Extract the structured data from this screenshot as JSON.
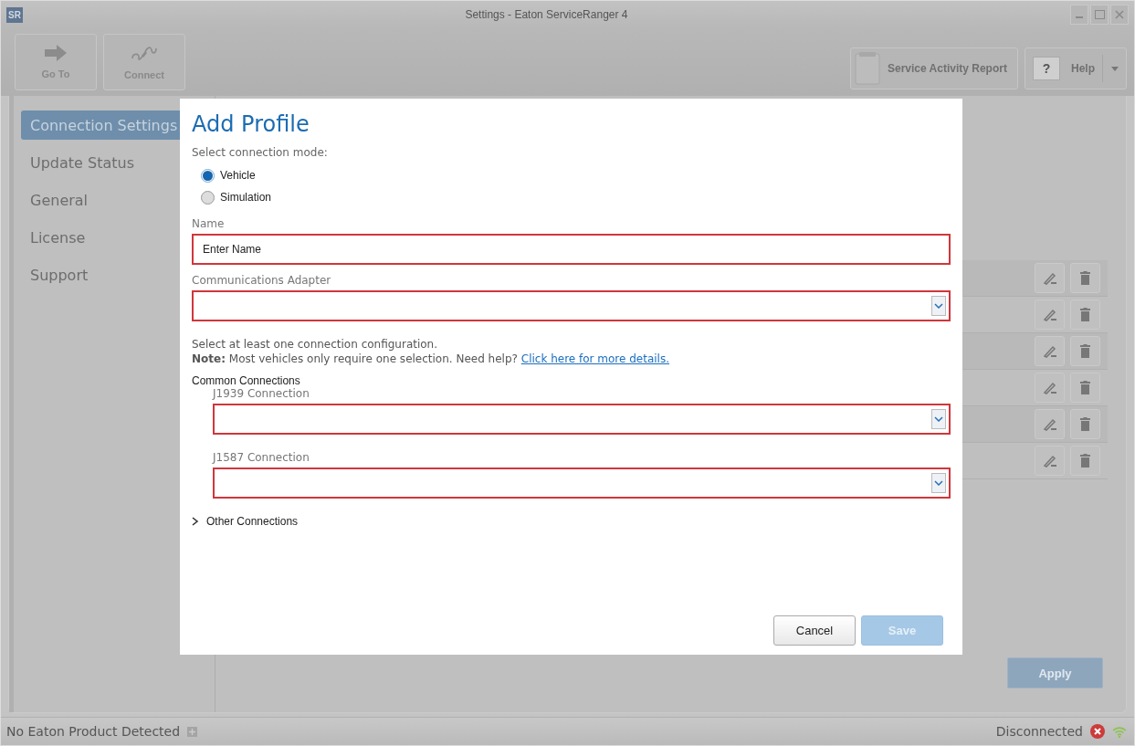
{
  "window": {
    "logo": "SR",
    "title": "Settings - Eaton ServiceRanger 4"
  },
  "toolbar": {
    "left": [
      {
        "label": "Go To",
        "kind": "arrow"
      },
      {
        "label": "Connect",
        "kind": "plug"
      }
    ],
    "service_report": {
      "label": "Service Activity Report"
    },
    "help": {
      "label": "Help",
      "icon": "?"
    }
  },
  "sidebar": {
    "items": [
      {
        "label": "Connection Settings",
        "selected": true
      },
      {
        "label": "Update Status",
        "selected": false
      },
      {
        "label": "General",
        "selected": false
      },
      {
        "label": "License",
        "selected": false
      },
      {
        "label": "Support",
        "selected": false
      }
    ]
  },
  "profile_rows": [
    {
      "kind": "profile"
    },
    {
      "kind": "profile"
    },
    {
      "kind": "profile"
    },
    {
      "kind": "profile"
    },
    {
      "kind": "profile"
    },
    {
      "kind": "profile"
    }
  ],
  "apply_button": {
    "label": "Apply",
    "disabled": true
  },
  "dialog": {
    "title": "Add Profile",
    "mode_label": "Select connection mode:",
    "modes": [
      {
        "label": "Vehicle",
        "selected": true
      },
      {
        "label": "Simulation",
        "selected": false
      }
    ],
    "name_field": {
      "label": "Name",
      "placeholder": "Enter Name",
      "invalid": true
    },
    "adapter_field": {
      "label": "Communications Adapter",
      "invalid": true
    },
    "instruction": "Select at least one connection configuration.",
    "note": "**Note:** Most vehicles only require one selection. Need help?",
    "note_link": "Click here for more details.",
    "common_label": "Common Connections",
    "connections": [
      {
        "label": "J1939 Connection",
        "invalid": true
      },
      {
        "label": "J1587 Connection",
        "invalid": true
      }
    ],
    "other": {
      "label": "Other Connections",
      "expanded": false
    },
    "cancel": "Cancel",
    "save": {
      "label": "Save",
      "disabled": true
    }
  },
  "status_bar": {
    "left": "No Eaton Product Detected",
    "right": "Disconnected"
  }
}
